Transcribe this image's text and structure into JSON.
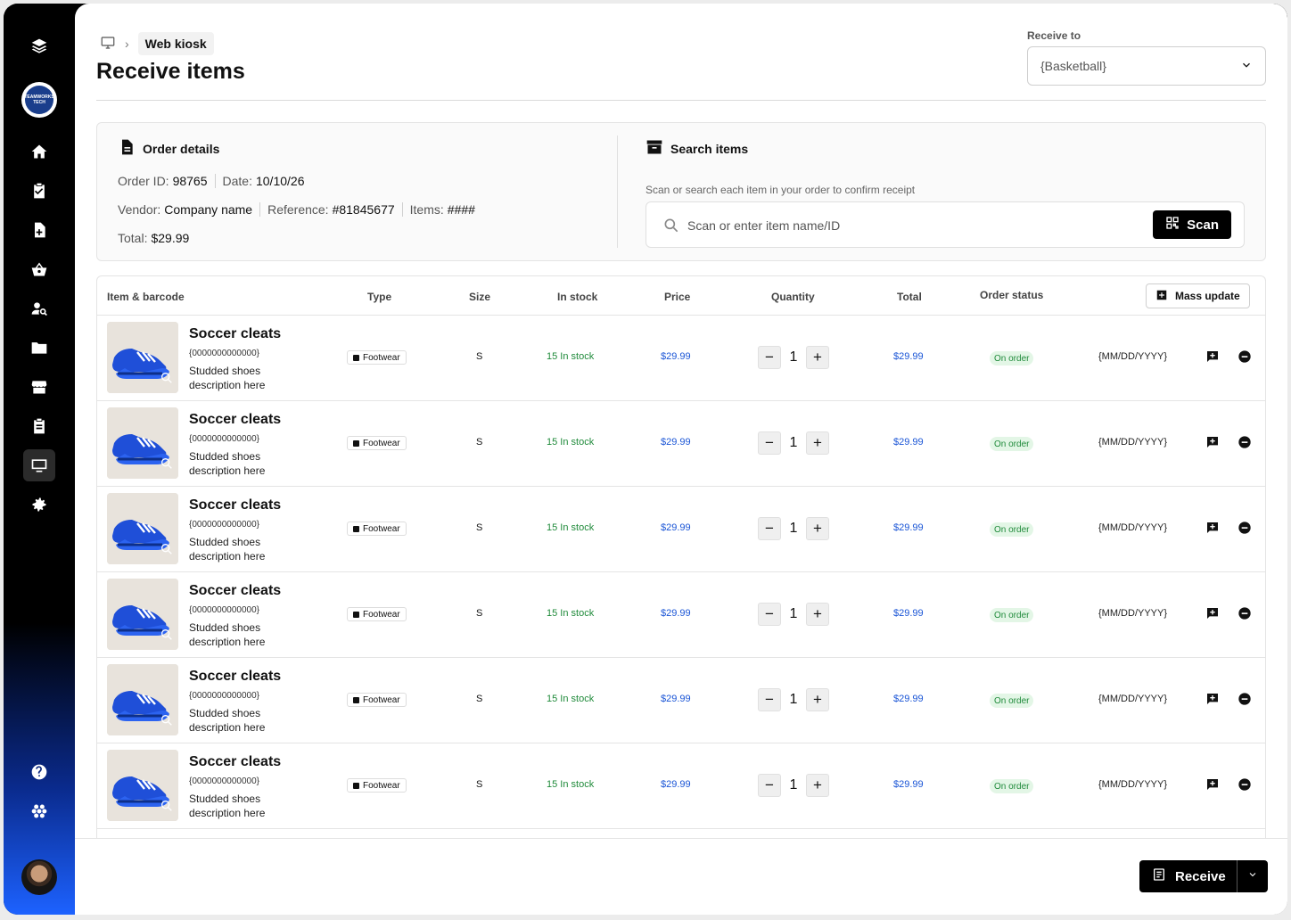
{
  "breadcrumb": {
    "current": "Web kiosk"
  },
  "page_title": "Receive items",
  "receive_to": {
    "label": "Receive to",
    "value": "{Basketball}"
  },
  "order_details": {
    "title": "Order details",
    "order_id_label": "Order ID:",
    "order_id": "98765",
    "date_label": "Date:",
    "date": "10/10/26",
    "vendor_label": "Vendor:",
    "vendor": "Company name",
    "reference_label": "Reference:",
    "reference": "#81845677",
    "items_label": "Items:",
    "items": "####",
    "total_label": "Total:",
    "total": "$29.99"
  },
  "search": {
    "title": "Search items",
    "hint": "Scan or search each item in your order to confirm receipt",
    "placeholder": "Scan or enter item name/ID",
    "scan_label": "Scan"
  },
  "table": {
    "headers": {
      "item": "Item & barcode",
      "type": "Type",
      "size": "Size",
      "stock": "In stock",
      "price": "Price",
      "quantity": "Quantity",
      "total": "Total",
      "status": "Order status"
    },
    "mass_update_label": "Mass update",
    "rows": [
      {
        "name": "Soccer cleats",
        "barcode": "{0000000000000}",
        "description": "Studded shoes description here",
        "type": "Footwear",
        "size": "S",
        "stock": "15 In stock",
        "price": "$29.99",
        "qty": "1",
        "total": "$29.99",
        "status": "On order",
        "date": "{MM/DD/YYYY}"
      },
      {
        "name": "Soccer cleats",
        "barcode": "{0000000000000}",
        "description": "Studded shoes description here",
        "type": "Footwear",
        "size": "S",
        "stock": "15 In stock",
        "price": "$29.99",
        "qty": "1",
        "total": "$29.99",
        "status": "On order",
        "date": "{MM/DD/YYYY}"
      },
      {
        "name": "Soccer cleats",
        "barcode": "{0000000000000}",
        "description": "Studded shoes description here",
        "type": "Footwear",
        "size": "S",
        "stock": "15 In stock",
        "price": "$29.99",
        "qty": "1",
        "total": "$29.99",
        "status": "On order",
        "date": "{MM/DD/YYYY}"
      },
      {
        "name": "Soccer cleats",
        "barcode": "{0000000000000}",
        "description": "Studded shoes description here",
        "type": "Footwear",
        "size": "S",
        "stock": "15 In stock",
        "price": "$29.99",
        "qty": "1",
        "total": "$29.99",
        "status": "On order",
        "date": "{MM/DD/YYYY}"
      },
      {
        "name": "Soccer cleats",
        "barcode": "{0000000000000}",
        "description": "Studded shoes description here",
        "type": "Footwear",
        "size": "S",
        "stock": "15 In stock",
        "price": "$29.99",
        "qty": "1",
        "total": "$29.99",
        "status": "On order",
        "date": "{MM/DD/YYYY}"
      },
      {
        "name": "Soccer cleats",
        "barcode": "{0000000000000}",
        "description": "Studded shoes description here",
        "type": "Footwear",
        "size": "S",
        "stock": "15 In stock",
        "price": "$29.99",
        "qty": "1",
        "total": "$29.99",
        "status": "On order",
        "date": "{MM/DD/YYYY}"
      }
    ]
  },
  "footer": {
    "receive_label": "Receive"
  },
  "sidebar": {
    "logo_text": "TEAMWORKS TECH",
    "icons": [
      "layers-icon",
      "home-icon",
      "clipboard-check-icon",
      "document-plus-icon",
      "basket-icon",
      "user-search-icon",
      "folder-icon",
      "store-icon",
      "clipboard-list-icon",
      "monitor-icon",
      "gear-icon",
      "help-icon",
      "apps-icon"
    ]
  },
  "colors": {
    "accent_blue": "#1a55d6",
    "status_green": "#1f8a3a",
    "sidebar_gradient_end": "#1d62ff"
  }
}
